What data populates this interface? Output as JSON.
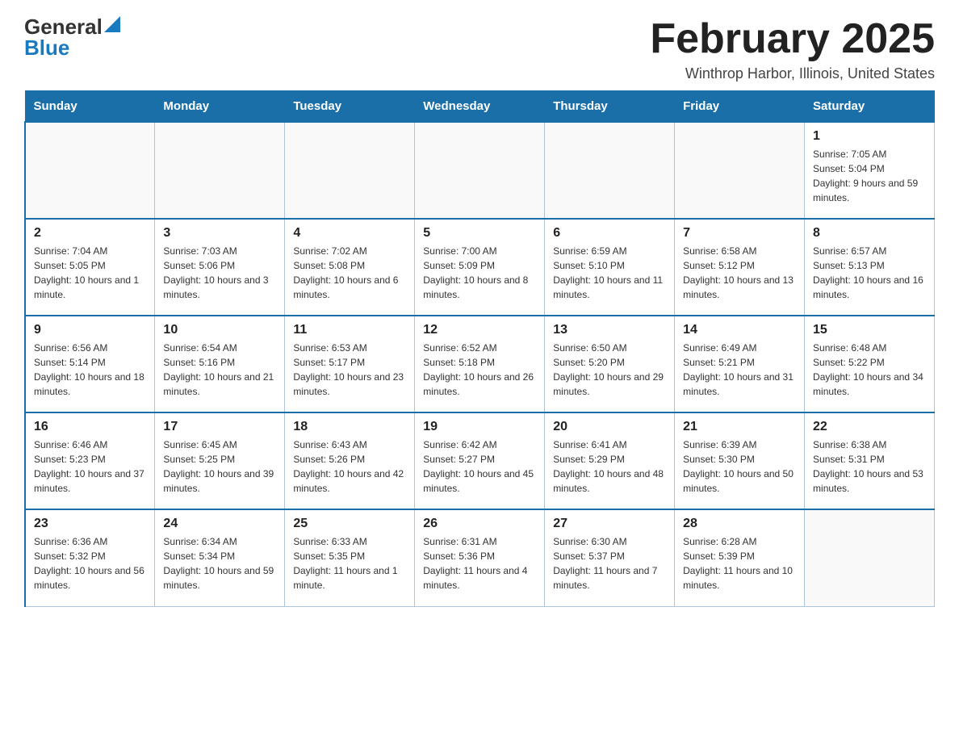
{
  "header": {
    "logo_general": "General",
    "logo_blue": "Blue",
    "month_title": "February 2025",
    "location": "Winthrop Harbor, Illinois, United States"
  },
  "days_of_week": [
    "Sunday",
    "Monday",
    "Tuesday",
    "Wednesday",
    "Thursday",
    "Friday",
    "Saturday"
  ],
  "weeks": [
    [
      {
        "day": "",
        "sunrise": "",
        "sunset": "",
        "daylight": ""
      },
      {
        "day": "",
        "sunrise": "",
        "sunset": "",
        "daylight": ""
      },
      {
        "day": "",
        "sunrise": "",
        "sunset": "",
        "daylight": ""
      },
      {
        "day": "",
        "sunrise": "",
        "sunset": "",
        "daylight": ""
      },
      {
        "day": "",
        "sunrise": "",
        "sunset": "",
        "daylight": ""
      },
      {
        "day": "",
        "sunrise": "",
        "sunset": "",
        "daylight": ""
      },
      {
        "day": "1",
        "sunrise": "Sunrise: 7:05 AM",
        "sunset": "Sunset: 5:04 PM",
        "daylight": "Daylight: 9 hours and 59 minutes."
      }
    ],
    [
      {
        "day": "2",
        "sunrise": "Sunrise: 7:04 AM",
        "sunset": "Sunset: 5:05 PM",
        "daylight": "Daylight: 10 hours and 1 minute."
      },
      {
        "day": "3",
        "sunrise": "Sunrise: 7:03 AM",
        "sunset": "Sunset: 5:06 PM",
        "daylight": "Daylight: 10 hours and 3 minutes."
      },
      {
        "day": "4",
        "sunrise": "Sunrise: 7:02 AM",
        "sunset": "Sunset: 5:08 PM",
        "daylight": "Daylight: 10 hours and 6 minutes."
      },
      {
        "day": "5",
        "sunrise": "Sunrise: 7:00 AM",
        "sunset": "Sunset: 5:09 PM",
        "daylight": "Daylight: 10 hours and 8 minutes."
      },
      {
        "day": "6",
        "sunrise": "Sunrise: 6:59 AM",
        "sunset": "Sunset: 5:10 PM",
        "daylight": "Daylight: 10 hours and 11 minutes."
      },
      {
        "day": "7",
        "sunrise": "Sunrise: 6:58 AM",
        "sunset": "Sunset: 5:12 PM",
        "daylight": "Daylight: 10 hours and 13 minutes."
      },
      {
        "day": "8",
        "sunrise": "Sunrise: 6:57 AM",
        "sunset": "Sunset: 5:13 PM",
        "daylight": "Daylight: 10 hours and 16 minutes."
      }
    ],
    [
      {
        "day": "9",
        "sunrise": "Sunrise: 6:56 AM",
        "sunset": "Sunset: 5:14 PM",
        "daylight": "Daylight: 10 hours and 18 minutes."
      },
      {
        "day": "10",
        "sunrise": "Sunrise: 6:54 AM",
        "sunset": "Sunset: 5:16 PM",
        "daylight": "Daylight: 10 hours and 21 minutes."
      },
      {
        "day": "11",
        "sunrise": "Sunrise: 6:53 AM",
        "sunset": "Sunset: 5:17 PM",
        "daylight": "Daylight: 10 hours and 23 minutes."
      },
      {
        "day": "12",
        "sunrise": "Sunrise: 6:52 AM",
        "sunset": "Sunset: 5:18 PM",
        "daylight": "Daylight: 10 hours and 26 minutes."
      },
      {
        "day": "13",
        "sunrise": "Sunrise: 6:50 AM",
        "sunset": "Sunset: 5:20 PM",
        "daylight": "Daylight: 10 hours and 29 minutes."
      },
      {
        "day": "14",
        "sunrise": "Sunrise: 6:49 AM",
        "sunset": "Sunset: 5:21 PM",
        "daylight": "Daylight: 10 hours and 31 minutes."
      },
      {
        "day": "15",
        "sunrise": "Sunrise: 6:48 AM",
        "sunset": "Sunset: 5:22 PM",
        "daylight": "Daylight: 10 hours and 34 minutes."
      }
    ],
    [
      {
        "day": "16",
        "sunrise": "Sunrise: 6:46 AM",
        "sunset": "Sunset: 5:23 PM",
        "daylight": "Daylight: 10 hours and 37 minutes."
      },
      {
        "day": "17",
        "sunrise": "Sunrise: 6:45 AM",
        "sunset": "Sunset: 5:25 PM",
        "daylight": "Daylight: 10 hours and 39 minutes."
      },
      {
        "day": "18",
        "sunrise": "Sunrise: 6:43 AM",
        "sunset": "Sunset: 5:26 PM",
        "daylight": "Daylight: 10 hours and 42 minutes."
      },
      {
        "day": "19",
        "sunrise": "Sunrise: 6:42 AM",
        "sunset": "Sunset: 5:27 PM",
        "daylight": "Daylight: 10 hours and 45 minutes."
      },
      {
        "day": "20",
        "sunrise": "Sunrise: 6:41 AM",
        "sunset": "Sunset: 5:29 PM",
        "daylight": "Daylight: 10 hours and 48 minutes."
      },
      {
        "day": "21",
        "sunrise": "Sunrise: 6:39 AM",
        "sunset": "Sunset: 5:30 PM",
        "daylight": "Daylight: 10 hours and 50 minutes."
      },
      {
        "day": "22",
        "sunrise": "Sunrise: 6:38 AM",
        "sunset": "Sunset: 5:31 PM",
        "daylight": "Daylight: 10 hours and 53 minutes."
      }
    ],
    [
      {
        "day": "23",
        "sunrise": "Sunrise: 6:36 AM",
        "sunset": "Sunset: 5:32 PM",
        "daylight": "Daylight: 10 hours and 56 minutes."
      },
      {
        "day": "24",
        "sunrise": "Sunrise: 6:34 AM",
        "sunset": "Sunset: 5:34 PM",
        "daylight": "Daylight: 10 hours and 59 minutes."
      },
      {
        "day": "25",
        "sunrise": "Sunrise: 6:33 AM",
        "sunset": "Sunset: 5:35 PM",
        "daylight": "Daylight: 11 hours and 1 minute."
      },
      {
        "day": "26",
        "sunrise": "Sunrise: 6:31 AM",
        "sunset": "Sunset: 5:36 PM",
        "daylight": "Daylight: 11 hours and 4 minutes."
      },
      {
        "day": "27",
        "sunrise": "Sunrise: 6:30 AM",
        "sunset": "Sunset: 5:37 PM",
        "daylight": "Daylight: 11 hours and 7 minutes."
      },
      {
        "day": "28",
        "sunrise": "Sunrise: 6:28 AM",
        "sunset": "Sunset: 5:39 PM",
        "daylight": "Daylight: 11 hours and 10 minutes."
      },
      {
        "day": "",
        "sunrise": "",
        "sunset": "",
        "daylight": ""
      }
    ]
  ]
}
